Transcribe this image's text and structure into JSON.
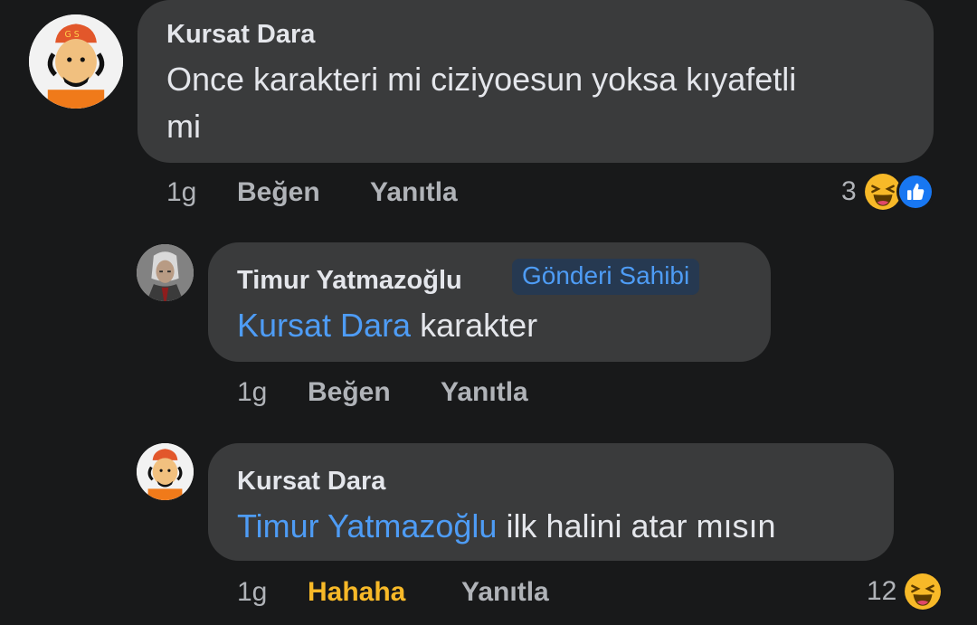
{
  "comments": [
    {
      "author": "Kursat Dara",
      "text_line1": "Once karakteri mi ciziyoesun yoksa kıyafetli",
      "text_line2": "mi",
      "time": "1g",
      "like_label": "Beğen",
      "reply_label": "Yanıtla",
      "reaction_count": "3",
      "reaction_icons": [
        "haha-icon",
        "like-icon"
      ]
    },
    {
      "author": "Timur Yatmazoğlu",
      "badge": "Gönderi Sahibi",
      "mention": "Kursat Dara",
      "text": " karakter",
      "time": "1g",
      "like_label": "Beğen",
      "reply_label": "Yanıtla"
    },
    {
      "author": "Kursat Dara",
      "mention": "Timur Yatmazoğlu",
      "text": " ilk halini atar mısın",
      "time": "1g",
      "like_label": "Hahaha",
      "reply_label": "Yanıtla",
      "reaction_count": "12",
      "reaction_icons": [
        "haha-icon"
      ]
    }
  ],
  "colors": {
    "background": "#18191a",
    "bubble": "#3a3b3c",
    "mention": "#4e9cf5",
    "badge_bg": "#263951",
    "action_text": "#b0b3b8",
    "reacted_haha": "#f7b928",
    "like_blue": "#1877f2"
  }
}
